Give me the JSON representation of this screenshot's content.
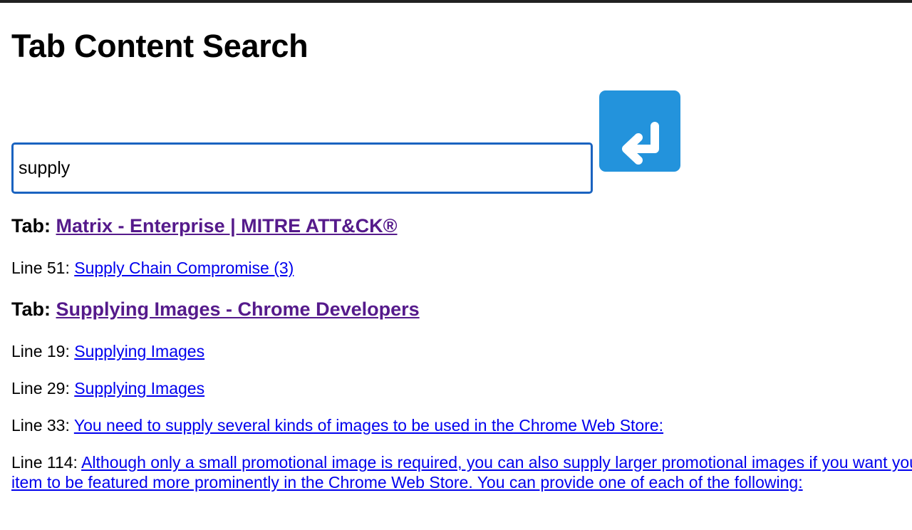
{
  "page": {
    "title": "Tab Content Search"
  },
  "search": {
    "value": "supply",
    "submit_icon": "return-arrow-icon",
    "accent_color": "#2393dc"
  },
  "results": {
    "tab_prefix": "Tab:",
    "tabs": [
      {
        "title": "Matrix - Enterprise | MITRE ATT&CK®",
        "lines": [
          {
            "label": "Line 51:",
            "text": "Supply Chain Compromise (3)"
          }
        ]
      },
      {
        "title": "Supplying Images - Chrome Developers",
        "lines": [
          {
            "label": "Line 19:",
            "text": "Supplying Images"
          },
          {
            "label": "Line 29:",
            "text": "Supplying Images"
          },
          {
            "label": "Line 33:",
            "text": "You need to supply several kinds of images to be used in the Chrome Web Store:"
          },
          {
            "label": "Line 114:",
            "text": "Although only a small promotional image is required, you can also supply larger promotional images if you want your item to be featured more prominently in the Chrome Web Store. You can provide one of each of the following:"
          }
        ]
      }
    ]
  }
}
